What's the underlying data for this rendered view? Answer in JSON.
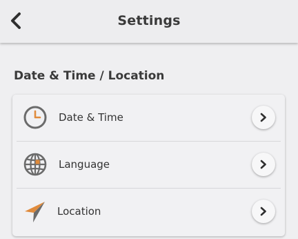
{
  "header": {
    "title": "Settings",
    "back_icon": "chevron-left-icon"
  },
  "section": {
    "title": "Date & Time / Location",
    "items": [
      {
        "label": "Date & Time",
        "icon": "clock-icon"
      },
      {
        "label": "Language",
        "icon": "globe-icon"
      },
      {
        "label": "Location",
        "icon": "navigation-arrow-icon"
      }
    ]
  },
  "colors": {
    "accent": "#e08b3c",
    "icon_gray": "#6b6b6b",
    "background": "#efeff1"
  }
}
